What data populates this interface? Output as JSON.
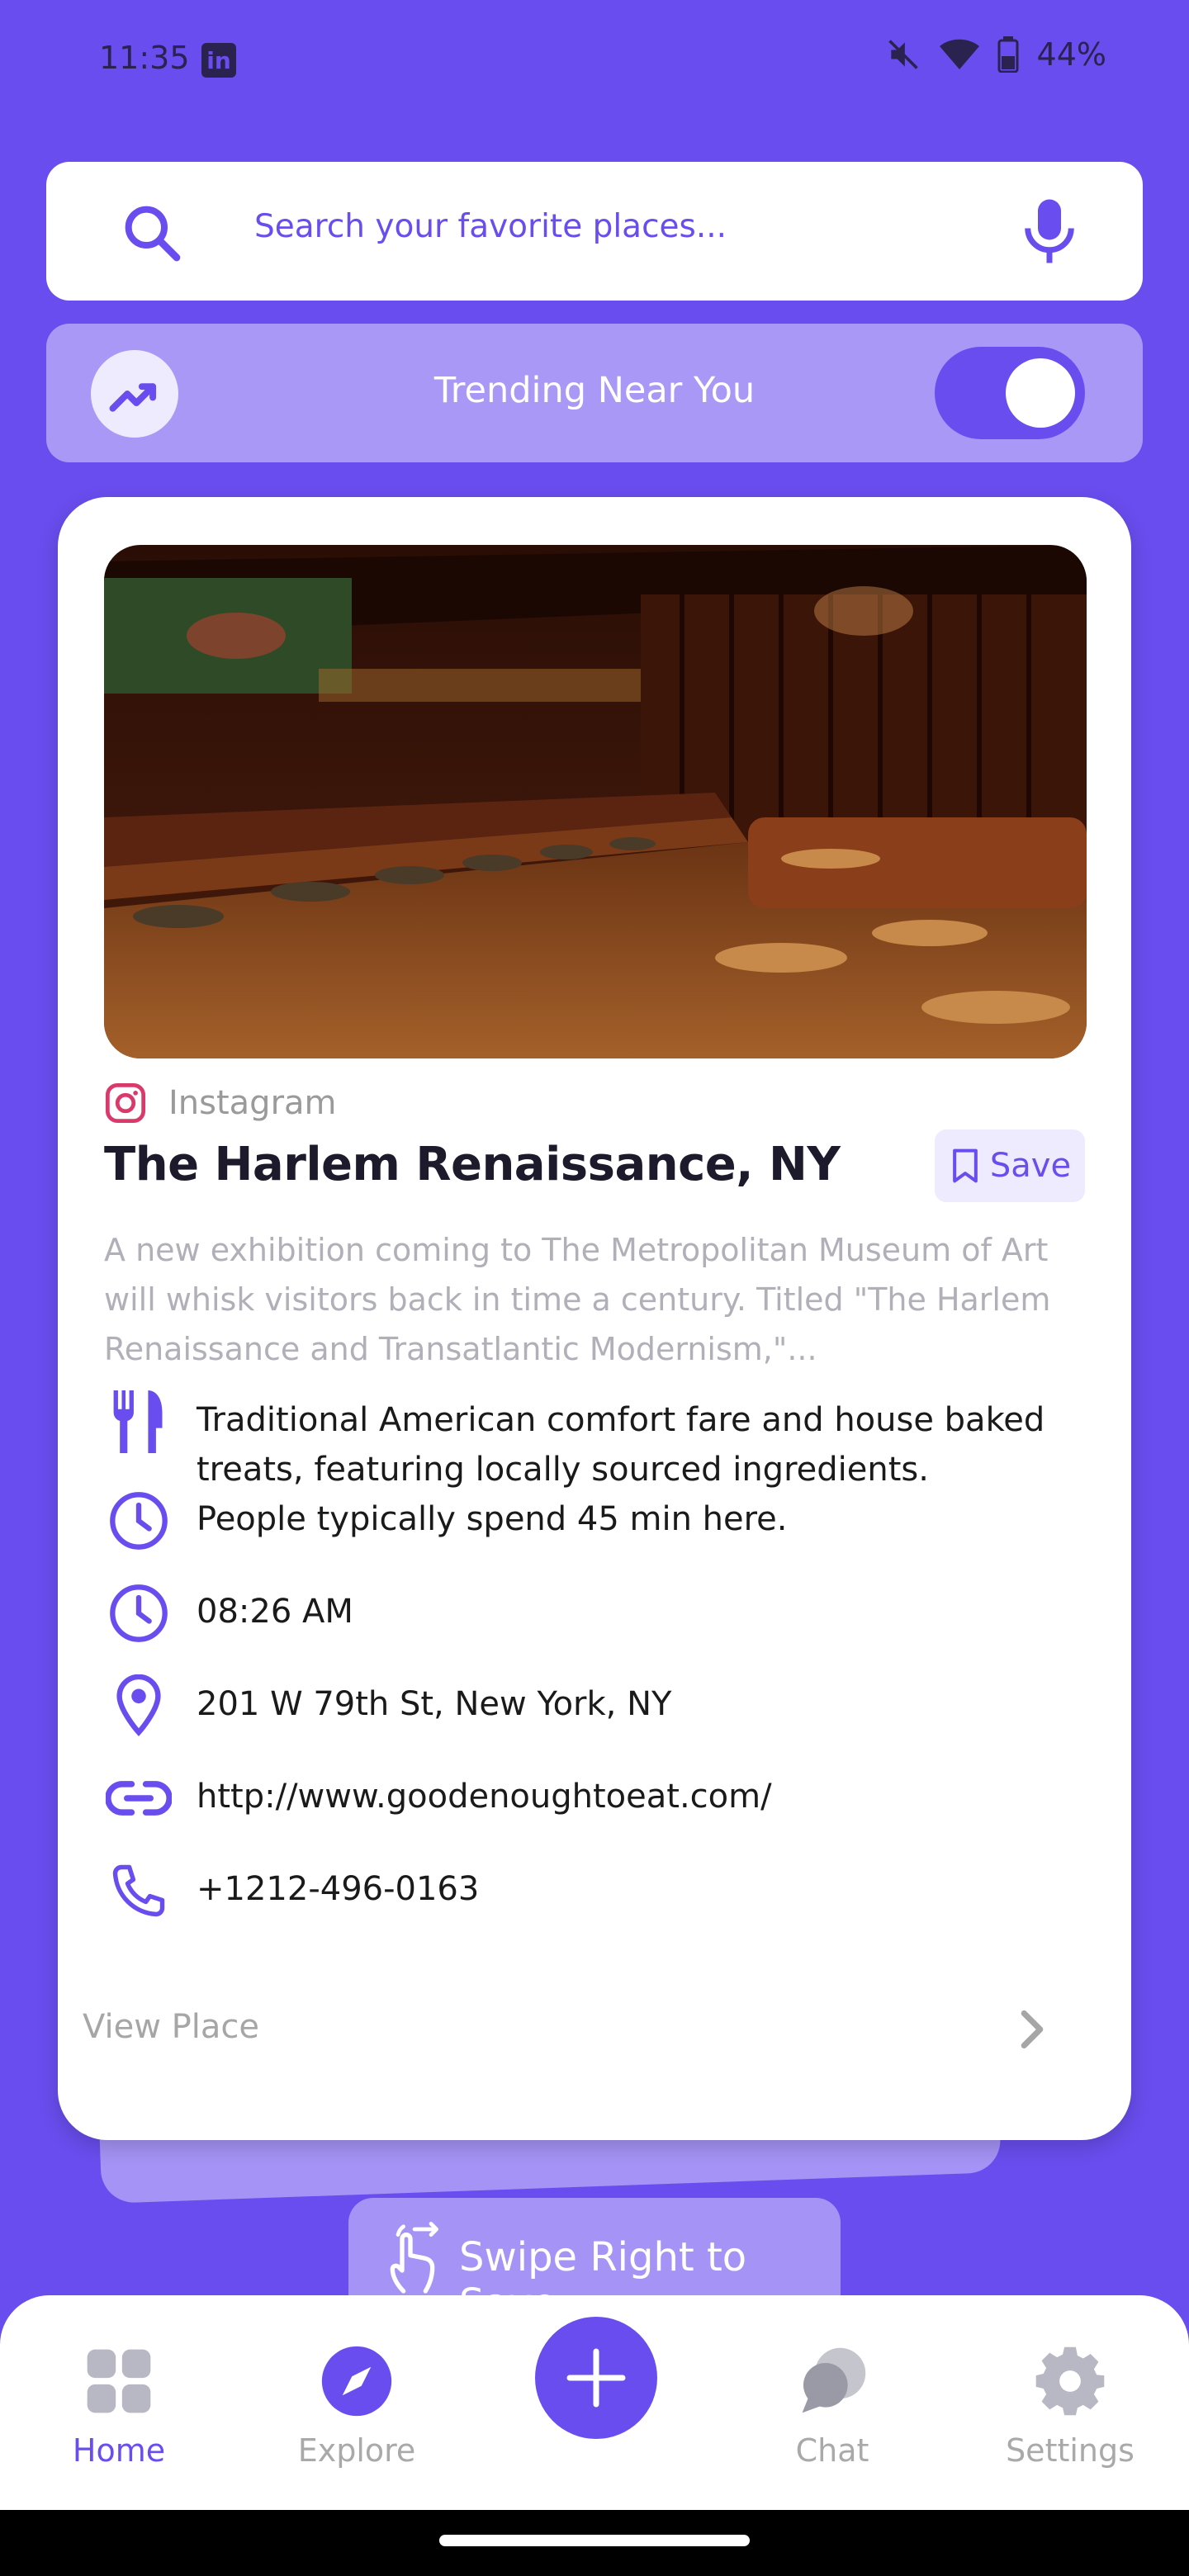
{
  "status_bar": {
    "time": "11:35",
    "battery": "44%"
  },
  "search": {
    "placeholder": "Search your favorite places..."
  },
  "trending": {
    "label": "Trending Near You",
    "toggle_on": true
  },
  "place": {
    "source": "Instagram",
    "title": "The Harlem Renaissance, NY",
    "save_label": "Save",
    "description": "A new exhibition coming to The Metropolitan Museum of Art will whisk visitors back in time a century. Titled \"The Harlem Renaissance and Transatlantic Modernism,\"...",
    "cuisine": "Traditional American comfort fare and house baked treats, featuring locally sourced ingredients.",
    "duration": "People typically spend 45 min here.",
    "time": "08:26 AM",
    "address": "201 W 79th St, New York, NY",
    "website": "http://www.goodenoughtoeat.com/",
    "phone": "+1212-496-0163",
    "view_label": "View Place"
  },
  "swipe_hint": {
    "label": "Swipe Right to Save"
  },
  "nav": {
    "items": [
      {
        "label": "Home",
        "icon": "grid-icon",
        "active": true
      },
      {
        "label": "Explore",
        "icon": "compass-icon",
        "active": false
      },
      {
        "label": "",
        "icon": "plus-icon",
        "active": false
      },
      {
        "label": "Chat",
        "icon": "chat-icon",
        "active": false
      },
      {
        "label": "Settings",
        "icon": "gear-icon",
        "active": false
      }
    ]
  },
  "colors": {
    "accent": "#6A4DEE",
    "accent_light": "#AA98F6",
    "muted": "#A9A9A9"
  }
}
